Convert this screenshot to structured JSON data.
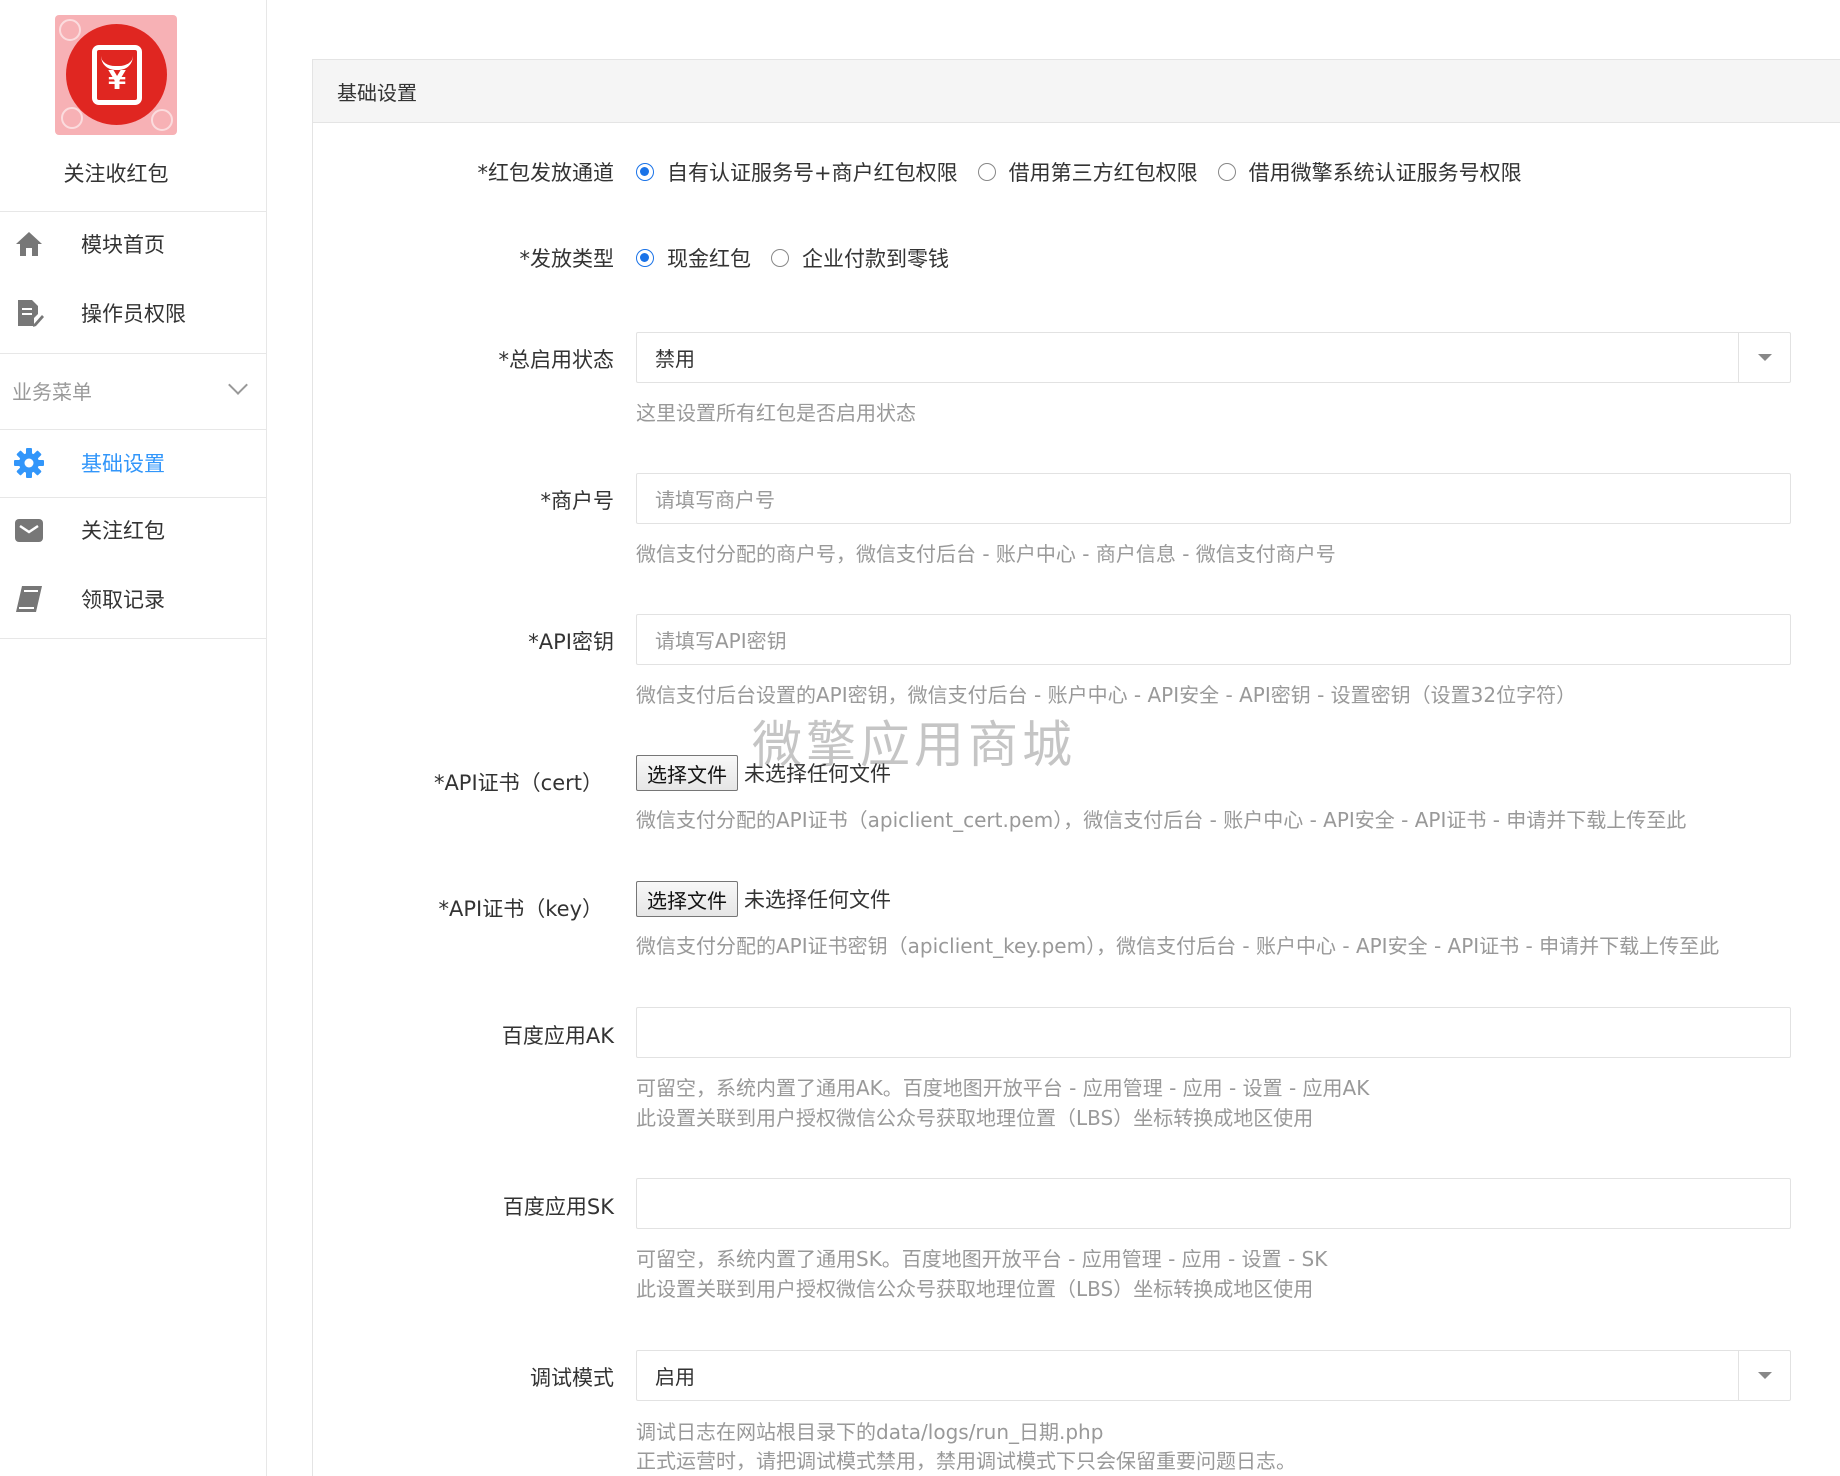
{
  "sidebar": {
    "app_name": "关注收红包",
    "top_items": [
      {
        "label": "模块首页",
        "icon": "home-icon"
      },
      {
        "label": "操作员权限",
        "icon": "document-edit-icon"
      }
    ],
    "menu_heading": "业务菜单",
    "menu_items": [
      {
        "label": "基础设置",
        "icon": "gear-icon",
        "active": true
      },
      {
        "label": "关注红包",
        "icon": "envelope-icon",
        "active": false
      },
      {
        "label": "领取记录",
        "icon": "book-icon",
        "active": false
      }
    ]
  },
  "panel": {
    "heading": "基础设置",
    "channel": {
      "label": "*红包发放通道",
      "options": [
        "自有认证服务号+商户红包权限",
        "借用第三方红包权限",
        "借用微擎系统认证服务号权限"
      ],
      "selected": 0
    },
    "issue_type": {
      "label": "*发放类型",
      "options": [
        "现金红包",
        "企业付款到零钱"
      ],
      "selected": 0
    },
    "status": {
      "label": "*总启用状态",
      "value": "禁用",
      "help": "这里设置所有红包是否启用状态"
    },
    "merchant_id": {
      "label": "*商户号",
      "placeholder": "请填写商户号",
      "help": "微信支付分配的商户号，微信支付后台 - 账户中心 - 商户信息 - 微信支付商户号"
    },
    "api_key": {
      "label": "*API密钥",
      "placeholder": "请填写API密钥",
      "help": "微信支付后台设置的API密钥，微信支付后台 - 账户中心 - API安全 - API密钥 - 设置密钥（设置32位字符）"
    },
    "cert": {
      "label": "*API证书（cert）",
      "button": "选择文件",
      "status": "未选择任何文件",
      "help": "微信支付分配的API证书（apiclient_cert.pem），微信支付后台 - 账户中心 - API安全 - API证书 - 申请并下载上传至此"
    },
    "key": {
      "label": "*API证书（key）",
      "button": "选择文件",
      "status": "未选择任何文件",
      "help": "微信支付分配的API证书密钥（apiclient_key.pem），微信支付后台 - 账户中心 - API安全 - API证书 - 申请并下载上传至此"
    },
    "baidu_ak": {
      "label": "百度应用AK",
      "value": "",
      "help1": "可留空，系统内置了通用AK。百度地图开放平台 - 应用管理 - 应用 - 设置 - 应用AK",
      "help2": "此设置关联到用户授权微信公众号获取地理位置（LBS）坐标转换成地区使用"
    },
    "baidu_sk": {
      "label": "百度应用SK",
      "value": "",
      "help1": "可留空，系统内置了通用SK。百度地图开放平台 - 应用管理 - 应用 - 设置 - SK",
      "help2": "此设置关联到用户授权微信公众号获取地理位置（LBS）坐标转换成地区使用"
    },
    "debug": {
      "label": "调试模式",
      "value": "启用",
      "help1": "调试日志在网站根目录下的data/logs/run_日期.php",
      "help2": "正式运营时，请把调试模式禁用，禁用调试模式下只会保留重要问题日志。"
    }
  },
  "watermark": "微擎应用商城",
  "colors": {
    "accent": "#3296fa",
    "logo_red": "#e02621",
    "logo_bg": "#f7b1b5"
  }
}
